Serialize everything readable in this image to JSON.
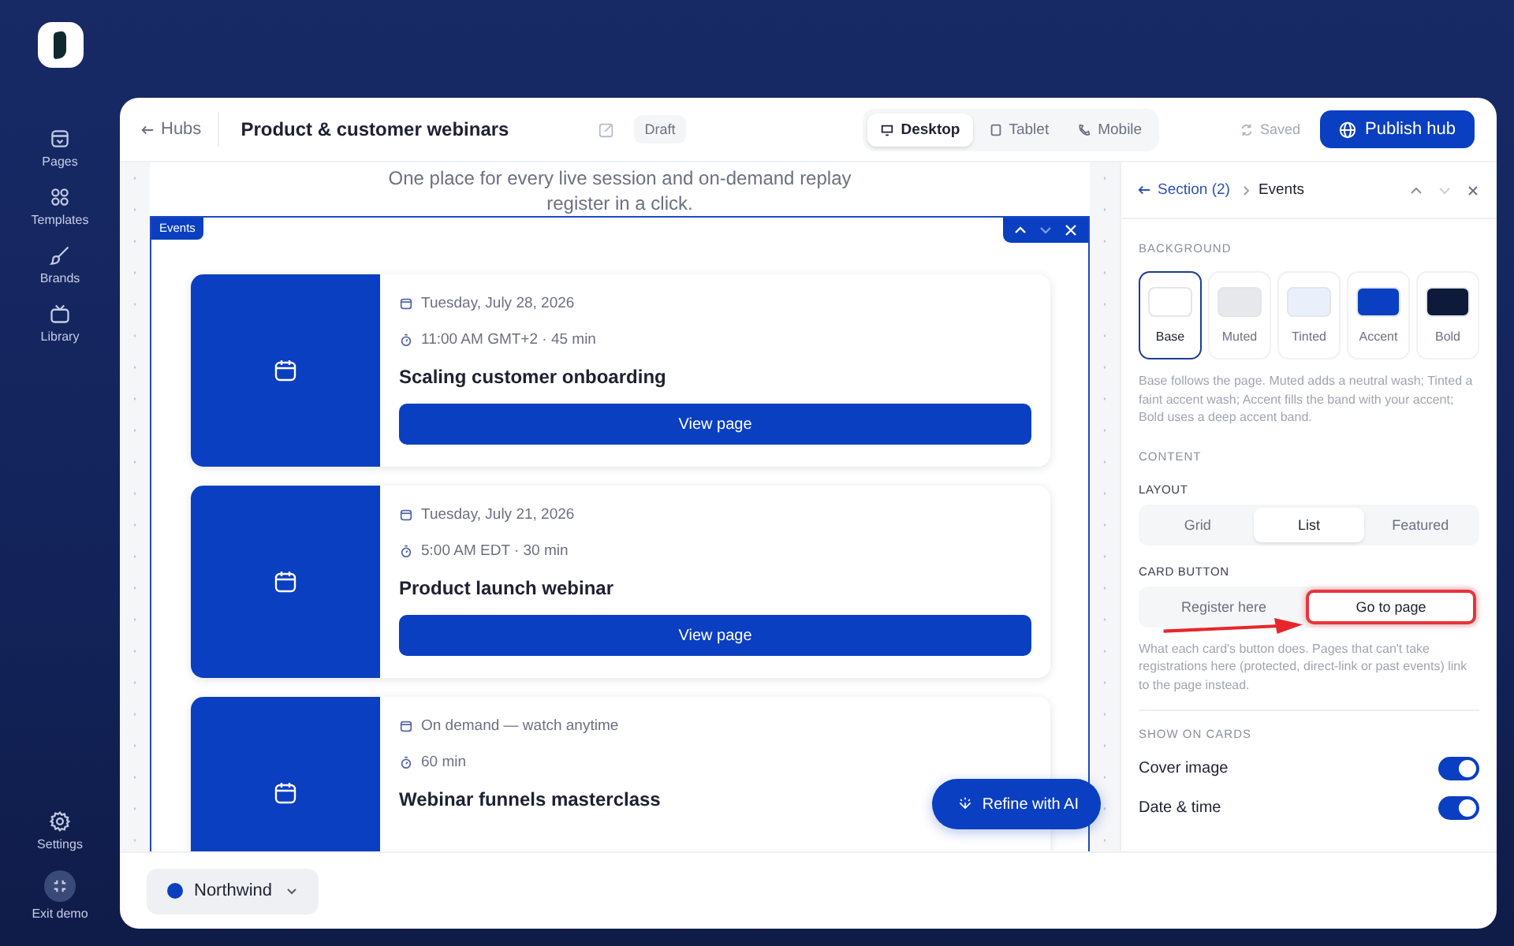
{
  "app_rail": {
    "nav": [
      {
        "label": "Pages"
      },
      {
        "label": "Templates"
      },
      {
        "label": "Brands"
      },
      {
        "label": "Library"
      }
    ],
    "footer": [
      {
        "label": "Settings"
      },
      {
        "label": "Exit demo"
      }
    ]
  },
  "toolbar": {
    "back": "Hubs",
    "title": "Product & customer webinars",
    "status_badge": "Draft",
    "devices": [
      {
        "label": "Desktop",
        "selected": true
      },
      {
        "label": "Tablet",
        "selected": false
      },
      {
        "label": "Mobile",
        "selected": false
      }
    ],
    "save_state": "Saved",
    "publish": "Publish hub"
  },
  "canvas": {
    "intro": [
      "One place for every live session and on-demand replay",
      "register in a click."
    ],
    "section_label": "Events",
    "events": [
      {
        "date": "Tuesday, July 28, 2026",
        "time": "11:00 AM GMT+2 · 45 min",
        "title": "Scaling customer onboarding",
        "button": "View page"
      },
      {
        "date": "Tuesday, July 21, 2026",
        "time": "5:00 AM EDT · 30 min",
        "title": "Product launch webinar",
        "button": "View page"
      },
      {
        "date": "On demand — watch anytime",
        "time": "60 min",
        "title": "Webinar funnels masterclass"
      }
    ],
    "refine_button": "Refine with AI"
  },
  "workspace": {
    "name": "Northwind",
    "color": "#0b3fc1"
  },
  "inspector": {
    "back": "Section (2)",
    "current": "Events",
    "background": {
      "heading": "BACKGROUND",
      "options": [
        {
          "label": "Base",
          "color": "#ffffff",
          "selected": true
        },
        {
          "label": "Muted",
          "color": "#e6e8ec",
          "selected": false
        },
        {
          "label": "Tinted",
          "color": "#eaf0fb",
          "selected": false
        },
        {
          "label": "Accent",
          "color": "#0b3fc1",
          "selected": false
        },
        {
          "label": "Bold",
          "color": "#0d1a3a",
          "selected": false
        }
      ],
      "help": "Base follows the page. Muted adds a neutral wash; Tinted a faint accent wash; Accent fills the band with your accent; Bold uses a deep accent band."
    },
    "content_heading": "CONTENT",
    "layout": {
      "label": "LAYOUT",
      "options": [
        {
          "label": "Grid",
          "selected": false
        },
        {
          "label": "List",
          "selected": true
        },
        {
          "label": "Featured",
          "selected": false
        }
      ]
    },
    "card_button": {
      "label": "CARD BUTTON",
      "options": [
        {
          "label": "Register here",
          "selected": false
        },
        {
          "label": "Go to page",
          "selected": true
        }
      ],
      "help": "What each card's button does. Pages that can't take registrations here (protected, direct-link or past events) link to the page instead."
    },
    "show_on_cards": {
      "heading": "SHOW ON CARDS",
      "toggles": [
        {
          "label": "Cover image",
          "on": true
        },
        {
          "label": "Date & time",
          "on": true
        }
      ]
    }
  }
}
